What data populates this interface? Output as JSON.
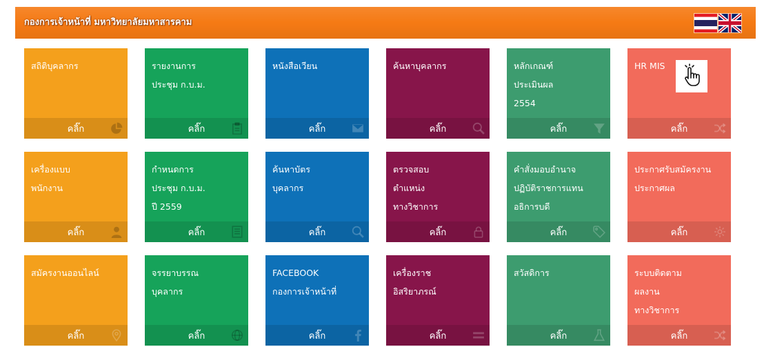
{
  "header": {
    "title": "กองการเจ้าหน้าที่ มหาวิทยาลัยมหาสารคาม",
    "color": "#f57a14",
    "flags": [
      "thai-flag",
      "uk-flag"
    ]
  },
  "tiles": [
    {
      "lines": [
        "สถิติบุคลากร"
      ],
      "button": "คลิ๊ก",
      "icon": "pie-chart-icon",
      "color": "#f4a01c"
    },
    {
      "lines": [
        "รายงานการ",
        "ประชุม ก.บ.ม."
      ],
      "button": "คลิ๊ก",
      "icon": "clipboard-icon",
      "color": "#16a35a"
    },
    {
      "lines": [
        "หนังสือเวียน"
      ],
      "button": "คลิ๊ก",
      "icon": "envelope-icon",
      "color": "#0e71b8"
    },
    {
      "lines": [
        "ค้นหาบุคลากร"
      ],
      "button": "คลิ๊ก",
      "icon": "search-icon",
      "color": "#87154a"
    },
    {
      "lines": [
        "หลักเกณฑ์",
        "ประเมินผล",
        "2554"
      ],
      "button": "คลิ๊ก",
      "icon": "filter-icon",
      "color": "#3d9c6f"
    },
    {
      "lines": [
        "HR MIS"
      ],
      "button": "คลิ๊ก",
      "icon": "shuffle-icon",
      "overlay_icon": "hand-pointer-icon",
      "color": "#f26b5b"
    },
    {
      "lines": [
        "เครื่องแบบ",
        "พนักงาน"
      ],
      "button": "คลิ๊ก",
      "icon": "user-icon",
      "color": "#f4a01c"
    },
    {
      "lines": [
        "กำหนดการ",
        "ประชุม ก.บ.ม.",
        "ปี 2559"
      ],
      "button": "คลิ๊ก",
      "icon": "list-icon",
      "color": "#16a35a"
    },
    {
      "lines": [
        "ค้นหาบัตร",
        "บุคลากร"
      ],
      "button": "คลิ๊ก",
      "icon": "search-icon",
      "color": "#0e71b8"
    },
    {
      "lines": [
        "ตรวจสอบ",
        "ตำแหน่ง",
        "ทางวิชาการ"
      ],
      "button": "คลิ๊ก",
      "icon": "lock-icon",
      "color": "#87154a"
    },
    {
      "lines": [
        "คำสั่งมอบอำนาจ",
        "ปฏิบัติราชการแทน",
        "อธิการบดี"
      ],
      "button": "คลิ๊ก",
      "icon": "tag-icon",
      "color": "#3d9c6f"
    },
    {
      "lines": [
        "ประกาศรับสมัครงาน",
        "ประกาศผล"
      ],
      "button": "คลิ๊ก",
      "icon": "gear-icon",
      "color": "#f26b5b"
    },
    {
      "lines": [
        "สมัครงานออนไลน์"
      ],
      "button": "คลิ๊ก",
      "icon": "map-marker-icon",
      "color": "#f4a01c"
    },
    {
      "lines": [
        "จรรยาบรรณ",
        "บุคลากร"
      ],
      "button": "คลิ๊ก",
      "icon": "globe-icon",
      "color": "#16a35a"
    },
    {
      "lines": [
        "FACEBOOK",
        "กองการเจ้าหน้าที่"
      ],
      "button": "คลิ๊ก",
      "icon": "facebook-icon",
      "color": "#0e71b8"
    },
    {
      "lines": [
        "เครื่องราช",
        "อิสริยาภรณ์"
      ],
      "button": "คลิ๊ก",
      "icon": "bars-icon",
      "color": "#87154a"
    },
    {
      "lines": [
        "สวัสดิการ"
      ],
      "button": "คลิ๊ก",
      "icon": "flask-icon",
      "color": "#3d9c6f"
    },
    {
      "lines": [
        "ระบบติดตาม",
        "ผลงาน",
        "ทางวิชาการ"
      ],
      "button": "คลิ๊ก",
      "icon": "shuffle-icon",
      "color": "#f26b5b"
    }
  ]
}
